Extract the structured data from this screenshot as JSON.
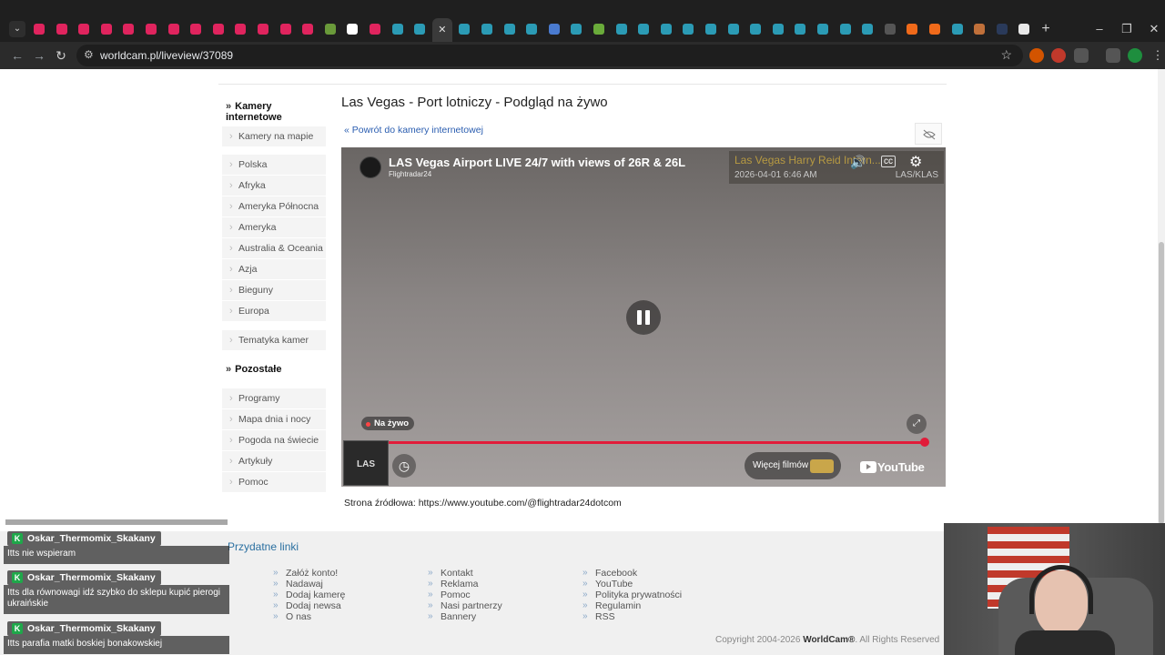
{
  "browser": {
    "url": "worldcam.pl/liveview/37089",
    "tabs": [
      {
        "color": "#e0245e"
      },
      {
        "color": "#e0245e"
      },
      {
        "color": "#e0245e"
      },
      {
        "color": "#e0245e"
      },
      {
        "color": "#e0245e"
      },
      {
        "color": "#e0245e"
      },
      {
        "color": "#e0245e"
      },
      {
        "color": "#e0245e"
      },
      {
        "color": "#e0245e"
      },
      {
        "color": "#e0245e"
      },
      {
        "color": "#e0245e"
      },
      {
        "color": "#e0245e"
      },
      {
        "color": "#e0245e"
      },
      {
        "color": "#6a9a3a"
      },
      {
        "color": "#ffffff"
      },
      {
        "color": "#e0245e"
      },
      {
        "color": "#2b9bb5"
      },
      {
        "color": "#2b9bb5"
      },
      {
        "color": "#3a3a3a"
      },
      {
        "color": "#2b9bb5"
      },
      {
        "color": "#2b9bb5"
      },
      {
        "color": "#2b9bb5"
      },
      {
        "color": "#2b9bb5"
      },
      {
        "color": "#4a7bd0"
      },
      {
        "color": "#2b9bb5"
      },
      {
        "color": "#6aab3a"
      },
      {
        "color": "#2b9bb5"
      },
      {
        "color": "#2b9bb5"
      },
      {
        "color": "#2b9bb5"
      },
      {
        "color": "#2b9bb5"
      },
      {
        "color": "#2b9bb5"
      },
      {
        "color": "#2b9bb5"
      },
      {
        "color": "#2b9bb5"
      },
      {
        "color": "#2b9bb5"
      },
      {
        "color": "#2b9bb5"
      },
      {
        "color": "#2b9bb5"
      },
      {
        "color": "#2b9bb5"
      },
      {
        "color": "#2b9bb5"
      },
      {
        "color": "#555555"
      },
      {
        "color": "#f06a1a"
      },
      {
        "color": "#f06a1a"
      },
      {
        "color": "#2b9bb5"
      },
      {
        "color": "#c0703a"
      },
      {
        "color": "#2a3a5a"
      },
      {
        "color": "#e8e8e8"
      }
    ],
    "new_tab_label": "+",
    "tab_list_label": "⌄"
  },
  "sidebar": {
    "heading1": "Kamery internetowe",
    "group1": [
      "Kamery na mapie"
    ],
    "group2": [
      "Polska",
      "Afryka",
      "Ameryka Północna",
      "Ameryka Południowa",
      "Australia & Oceania",
      "Azja",
      "Bieguny",
      "Europa"
    ],
    "group3": [
      "Tematyka kamer"
    ],
    "heading2": "Pozostałe",
    "group4": [
      "Programy",
      "Mapa dnia i nocy",
      "Pogoda na świecie",
      "Artykuły",
      "Pomoc"
    ]
  },
  "main": {
    "title": "Las Vegas - Port lotniczy - Podgląd na żywo",
    "back_link": "« Powrót do kamery internetowej",
    "source": "Strona źródłowa: https://www.youtube.com/@flightradar24dotcom"
  },
  "video": {
    "title": "LAS Vegas Airport LIVE 24/7 with views of 26R & 26L",
    "channel": "Flightradar24",
    "overlay_title": "Las Vegas Harry Reid Intern...",
    "overlay_date": "2026-04-01   6:46 AM",
    "overlay_code": "LAS/KLAS",
    "live_label": "Na żywo",
    "progress": 1.0,
    "more_videos": "Więcej filmów",
    "youtube_label": "YouTube",
    "thumb_label": "LAS"
  },
  "footer": {
    "title": "Przydatne linki",
    "col1": [
      "Załóż konto!",
      "Nadawaj",
      "Dodaj kamerę",
      "Dodaj newsa",
      "O nas"
    ],
    "col2": [
      "Kontakt",
      "Reklama",
      "Pomoc",
      "Nasi partnerzy",
      "Bannery"
    ],
    "col3": [
      "Facebook",
      "YouTube",
      "Polityka prywatności",
      "Regulamin",
      "RSS"
    ],
    "copyright_prefix": "Copyright 2004-2026",
    "copyright_brand": "WorldCam®",
    "copyright_suffix": ". All Rights Reserved"
  },
  "chat": [
    {
      "user": "Oskar_Thermomix_Skakany",
      "message": "Itts nie wspieram"
    },
    {
      "user": "Oskar_Thermomix_Skakany",
      "message": "Itts dla równowagi idź szybko do sklepu kupić pierogi ukraińskie"
    },
    {
      "user": "Oskar_Thermomix_Skakany",
      "message": "Itts parafia matki boskiej bonakowskiej"
    }
  ]
}
